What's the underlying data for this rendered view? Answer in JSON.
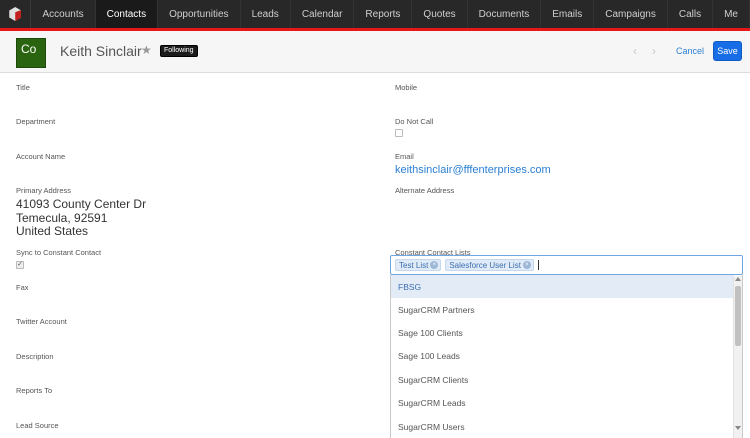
{
  "nav": {
    "items": [
      "Accounts",
      "Contacts",
      "Opportunities",
      "Leads",
      "Calendar",
      "Reports",
      "Quotes",
      "Documents",
      "Emails",
      "Campaigns",
      "Calls",
      "Me"
    ],
    "active": "Contacts"
  },
  "header": {
    "avatar_text": "Co",
    "name": "Keith Sinclair",
    "star": "★",
    "following": "Following",
    "prev": "‹",
    "next": "›",
    "cancel": "Cancel",
    "save": "Save"
  },
  "fields": {
    "title": "Title",
    "mobile": "Mobile",
    "department": "Department",
    "do_not_call": "Do Not Call",
    "account_name": "Account Name",
    "email_label": "Email",
    "email_value": "keithsinclair@fffenterprises.com",
    "primary_address": "Primary Address",
    "address_line1": "41093 County Center Dr",
    "address_line2": "Temecula, 92591",
    "address_line3": "United States",
    "alternate_address": "Alternate Address",
    "sync_cc": "Sync to Constant Contact",
    "cc_lists": "Constant Contact Lists",
    "fax": "Fax",
    "twitter": "Twitter Account",
    "description": "Description",
    "reports_to": "Reports To",
    "lead_source": "Lead Source"
  },
  "multiselect": {
    "selected": [
      "Test List",
      "Salesforce User List"
    ],
    "remove_glyph": "×",
    "options": [
      "FBSG",
      "SugarCRM Partners",
      "Sage 100 Clients",
      "Sage 100 Leads",
      "SugarCRM Clients",
      "SugarCRM Leads",
      "SugarCRM Users"
    ],
    "highlighted": "FBSG"
  },
  "colors": {
    "accent": "#176de5",
    "nav_bg": "#282828",
    "brand_red": "#e61718",
    "avatar_bg": "#2b6411"
  }
}
